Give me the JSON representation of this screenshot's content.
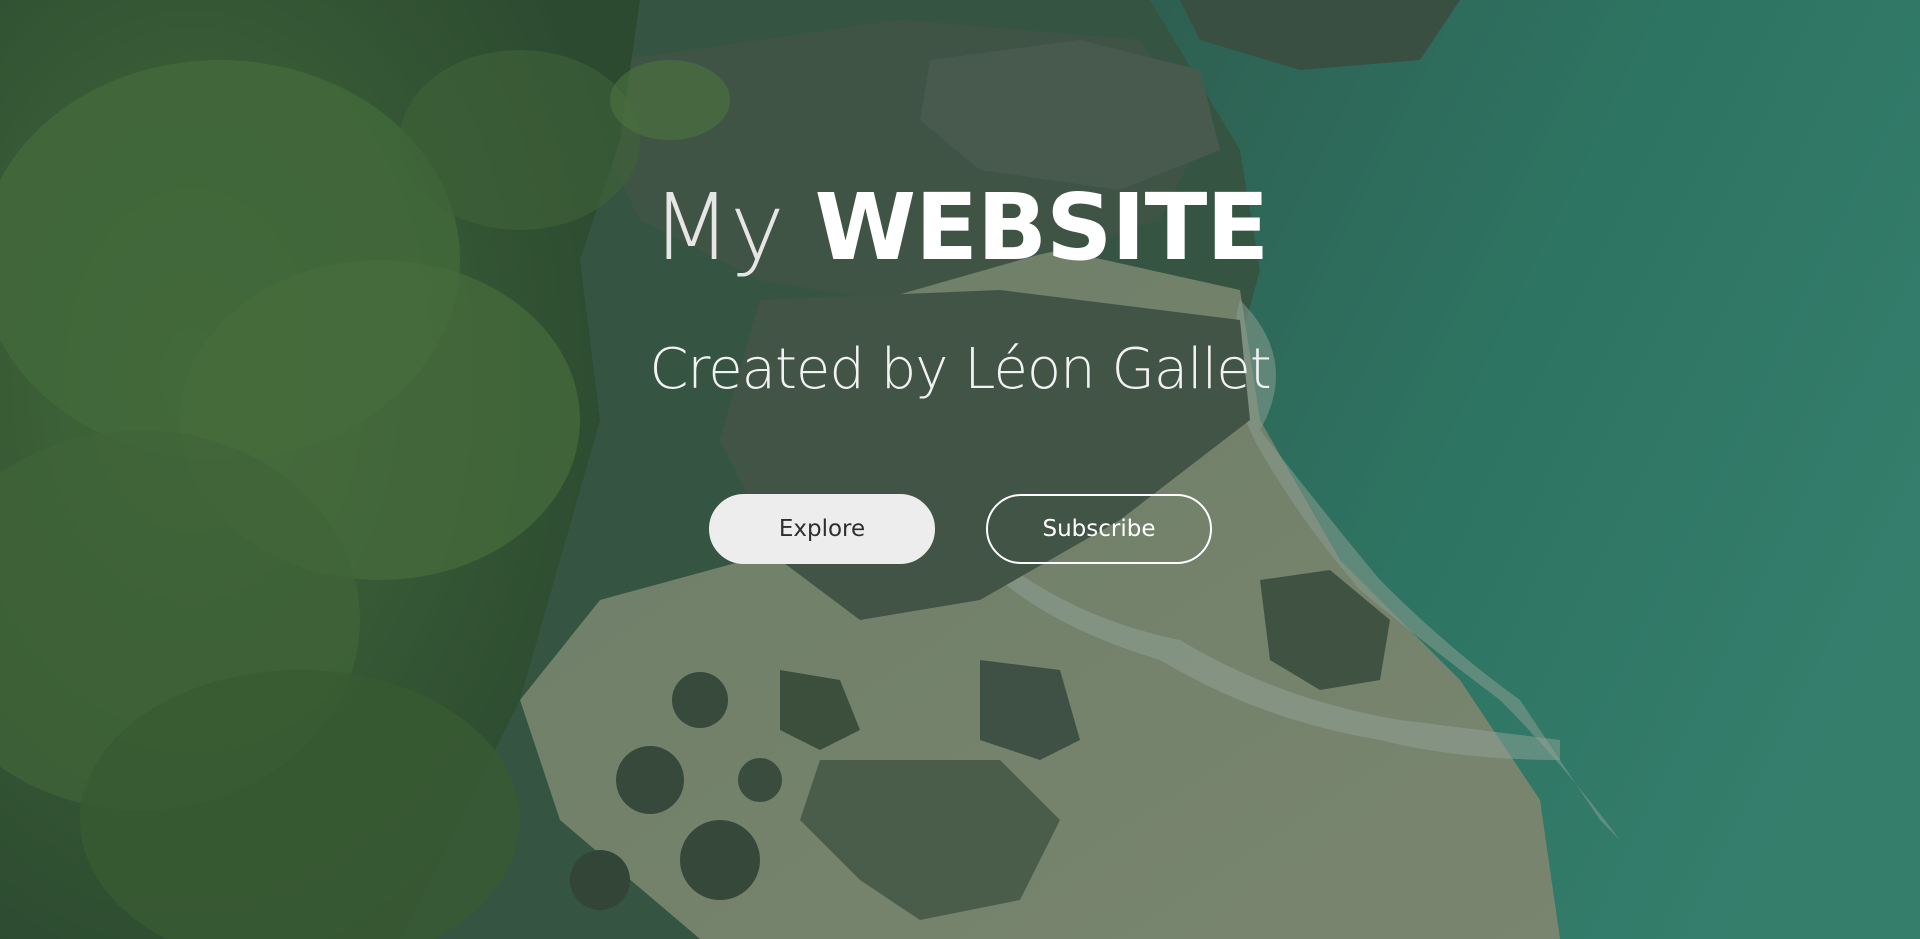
{
  "hero": {
    "title_light": "My",
    "title_bold": "WEBSITE",
    "subtitle": "Created by Léon Gallet",
    "background": "aerial-coastline-photo",
    "overlay_color": "#2f4a3a"
  },
  "actions": {
    "explore_label": "Explore",
    "subscribe_label": "Subscribe"
  }
}
